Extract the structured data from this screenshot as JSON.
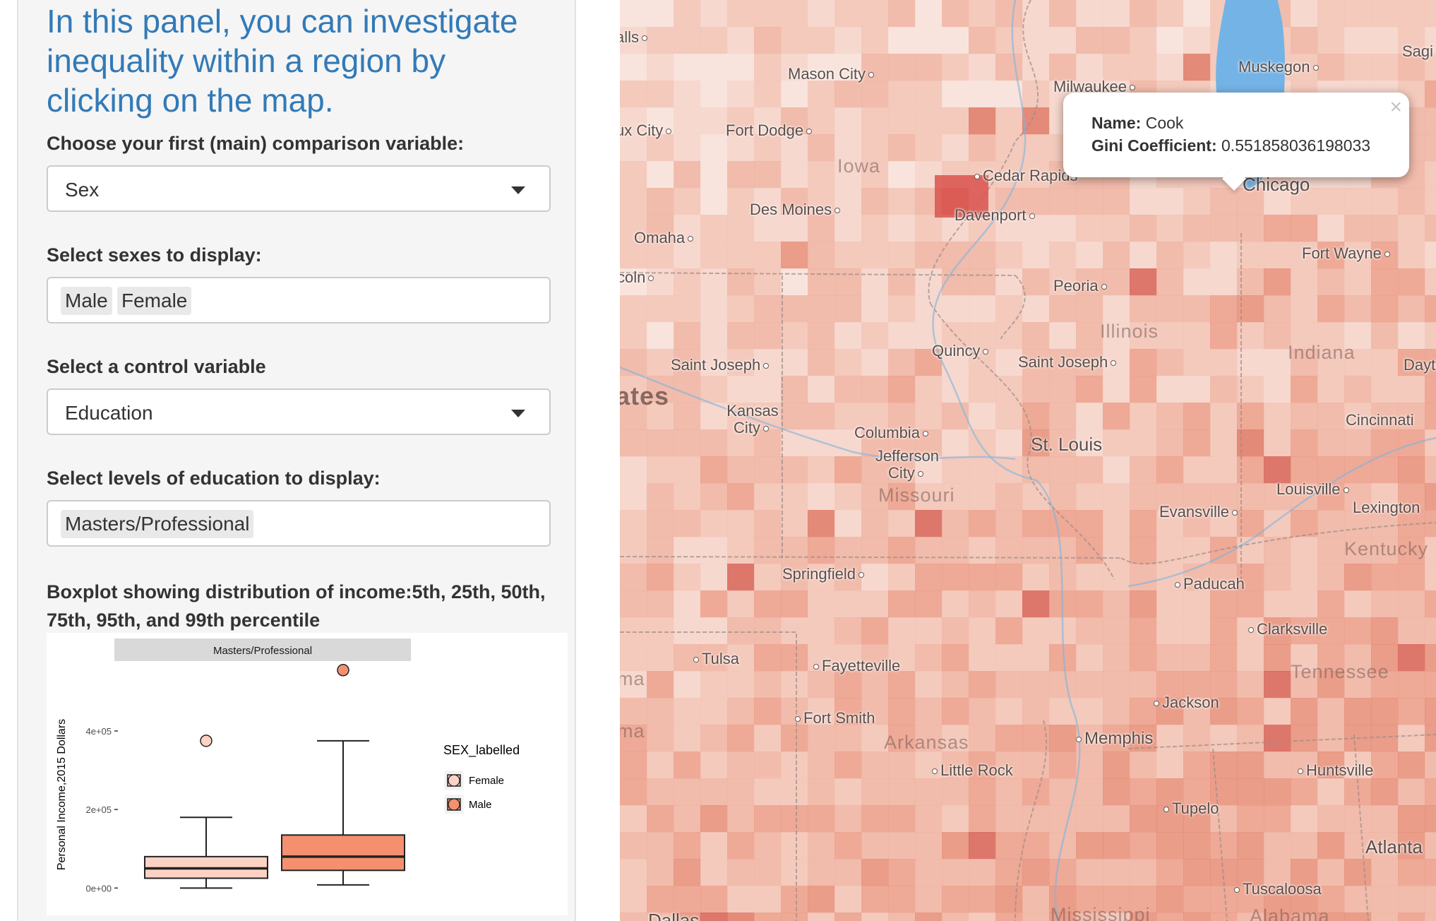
{
  "sidebar": {
    "title": "In this panel, you can investigate inequality within a region by clicking on the map.",
    "main_var_label": "Choose your first (main) comparison variable:",
    "main_var_value": "Sex",
    "sexes_label": "Select sexes to display:",
    "sexes_selected": [
      "Male",
      "Female"
    ],
    "control_label": "Select a control variable",
    "control_value": "Education",
    "levels_label": "Select levels of education to display:",
    "levels_selected": [
      "Masters/Professional"
    ],
    "plot_title": "Boxplot showing distribution of income:5th, 25th, 50th, 75th, 95th, and 99th percentile"
  },
  "chart_data": {
    "type": "boxplot",
    "facet_label": "Masters/Professional",
    "ylabel": "Personal Income,2015 Dollars",
    "ytick_labels": [
      "0e+00",
      "2e+05",
      "4e+05"
    ],
    "yticks": [
      0,
      200000,
      400000
    ],
    "ylim": [
      -12000,
      560000
    ],
    "legend_title": "SEX_labelled",
    "legend_position": "right",
    "colors": {
      "Female": "#fcd2c4",
      "Male": "#f4906f"
    },
    "series": [
      {
        "name": "Female",
        "p5": 0,
        "p25": 25000,
        "p50": 50000,
        "p75": 80000,
        "p95": 180000,
        "outliers": [
          375000
        ]
      },
      {
        "name": "Male",
        "p5": 8000,
        "p25": 45000,
        "p50": 80000,
        "p75": 135000,
        "p95": 375000,
        "outliers": [
          555000
        ]
      }
    ]
  },
  "map": {
    "popup": {
      "name_label": "Name:",
      "name_value": "Cook",
      "gini_label": "Gini Coefficient:",
      "gini_value": "0.551858036198033",
      "close_glyph": "×"
    },
    "cities": [
      "Muskegon",
      "Milwaukee",
      "Mason City",
      "alls",
      "Sagi",
      "Fort Dodge",
      "ux City",
      "Iowa",
      "Cedar Rapids",
      "Chicago",
      "Des Moines",
      "Davenport",
      "Omaha",
      "Fort Wayne",
      "coln",
      "Peoria",
      "Illinois",
      "Quincy",
      "Indiana",
      "Dayto",
      "Saint Joseph",
      "Springfield",
      "ates",
      "Kansas City",
      "Columbia",
      "Jefferson City",
      "Missouri",
      "St. Louis",
      "Cincinnati",
      "Louisville",
      "Lexington",
      "Evansville",
      "Kentucky",
      "Springfield",
      "Paducah",
      "Clarksville",
      "Tulsa",
      "Fayetteville",
      "Tennessee",
      "ma",
      "Jackson",
      "Fort Smith",
      "Memphis",
      "Arkansas",
      "Little Rock",
      "Huntsville",
      "Tupelo",
      "Atlanta",
      "Tuscaloosa",
      "Mississippi",
      "Alabama",
      "Dallas"
    ],
    "accent_water": "#74b3e6",
    "choropleth_base": "#f2b6a6"
  }
}
